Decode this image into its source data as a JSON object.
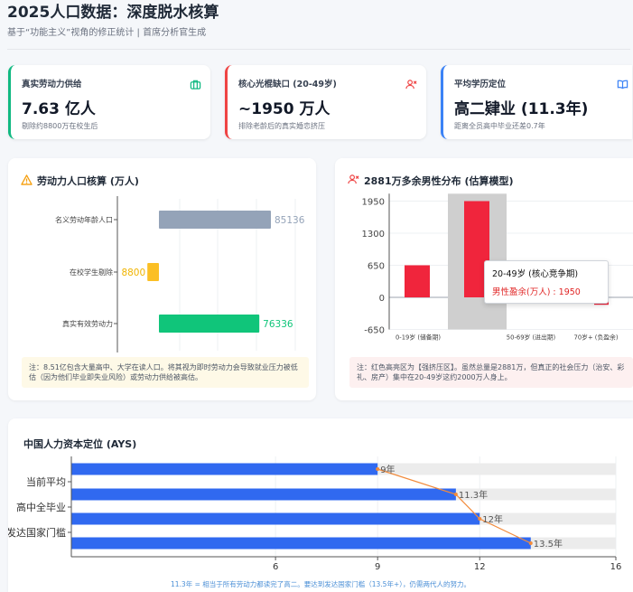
{
  "header": {
    "title": "2025人口数据：深度脱水核算",
    "subtitle": "基于“功能主义”视角的修正统计 | 首席分析官生成"
  },
  "kpis": [
    {
      "label": "真实劳动力供给",
      "value": "7.63 亿人",
      "note": "剔除约8800万在校生后",
      "color": "#10b981",
      "icon": "briefcase-icon"
    },
    {
      "label": "核心光棍缺口 (20-49岁)",
      "value": "~1950 万人",
      "note": "排除老龄后的真实婚恋挤压",
      "color": "#ef4444",
      "icon": "user-remove-icon"
    },
    {
      "label": "平均学历定位",
      "value": "高二肄业 (11.3年)",
      "note": "距离全员高中毕业还差0.7年",
      "color": "#3b82f6",
      "icon": "book-open-icon"
    }
  ],
  "labor_panel": {
    "title": "劳动力人口核算 (万人)",
    "icon": "warning-icon",
    "footnote": "注：8.51亿包含大量高中、大学在读人口。将其视为即时劳动力会导致就业压力被低估（因为他们毕业即失业风险）或劳动力供给被高估。"
  },
  "gender_panel": {
    "title": "2881万多余男性分布 (估算模型)",
    "icon": "user-remove-icon",
    "footnote": "注：红色高亮区为【强挤压区】。虽然总量是2881万，但真正的社会压力（治安、彩礼、房产）集中在20-49岁这约2000万人身上。",
    "tooltip_title": "20-49岁 (核心竞争期)",
    "tooltip_value": "男性盈余(万人) : 1950"
  },
  "ays_panel": {
    "title": "中国人力资本定位 (AYS)",
    "footnote": "11.3年 = 相当于所有劳动力都读完了高二。要达到发达国家门槛（13.5年+），仍需两代人的努力。"
  },
  "chart_data": [
    {
      "type": "bar",
      "orientation": "horizontal",
      "title": "劳动力人口核算 (万人)",
      "categories": [
        "名义劳动年龄人口",
        "在校学生剔除",
        "真实有效劳动力"
      ],
      "values": [
        85136,
        -8800,
        76336
      ],
      "labels": [
        "85136",
        "-8800",
        "76336"
      ],
      "colors": [
        "#94a3b8",
        "#fbbf24",
        "#10c57a"
      ],
      "xlim": [
        -12000,
        100000
      ]
    },
    {
      "type": "bar",
      "title": "2881万多余男性分布 (估算模型)",
      "categories": [
        "0-19岁 (储备期)",
        "20-49岁 (核心竞争期)",
        "50-69岁 (进出期)",
        "70岁+ (负盈余)"
      ],
      "tick_labels": [
        "0-19岁 (储备期)",
        "",
        "50-69岁 (进出期)",
        "70岁+ (负盈余)"
      ],
      "values": [
        650,
        1950,
        450,
        -150
      ],
      "ylim": [
        -650,
        2100
      ],
      "yticks": [
        -650,
        0,
        650,
        1300,
        1950
      ],
      "highlight_category": "20-49岁 (核心竞争期)",
      "series_name": "男性盈余(万人)"
    },
    {
      "type": "bar",
      "orientation": "horizontal",
      "title": "中国人力资本定位 (AYS)",
      "categories": [
        "当前平均",
        "高中全毕业",
        "",
        "发达国家门槛"
      ],
      "tick_labels": [
        "当前平均",
        "高中全毕业",
        "发达国家门槛"
      ],
      "values": [
        9,
        11.3,
        12,
        13.5
      ],
      "labels": [
        "9年",
        "11.3年",
        "12年",
        "13.5年"
      ],
      "track_max": 16,
      "xlim": [
        0,
        16
      ],
      "xticks": [
        6,
        9,
        12,
        16
      ]
    }
  ]
}
